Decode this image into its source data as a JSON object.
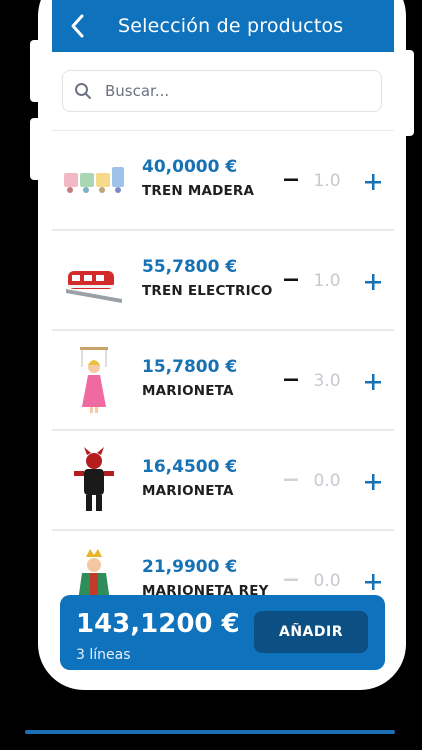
{
  "header": {
    "title": "Selección de productos",
    "back_icon": "chevron-left-icon"
  },
  "search": {
    "placeholder": "Buscar...",
    "value": ""
  },
  "products": [
    {
      "price": "40,0000 €",
      "name": "TREN MADERA",
      "qty": "1.0",
      "thumb": "wooden-train"
    },
    {
      "price": "55,7800 €",
      "name": "TREN ELECTRICO",
      "qty": "1.0",
      "thumb": "electric-train"
    },
    {
      "price": "15,7800 €",
      "name": "MARIONETA",
      "qty": "3.0",
      "thumb": "marionette-princess"
    },
    {
      "price": "16,4500 €",
      "name": "MARIONETA",
      "qty": "0.0",
      "thumb": "marionette-devil"
    },
    {
      "price": "21,9900 €",
      "name": "MARIONETA REY",
      "qty": "0.0",
      "thumb": "marionette-king"
    }
  ],
  "footer": {
    "total": "143,1200 €",
    "lines": "3 líneas",
    "add_label": "AÑADIR"
  },
  "colors": {
    "primary": "#0f72bd",
    "dark_button": "#0c4f82",
    "price": "#1672b5",
    "qty_muted": "#c5cad1"
  }
}
